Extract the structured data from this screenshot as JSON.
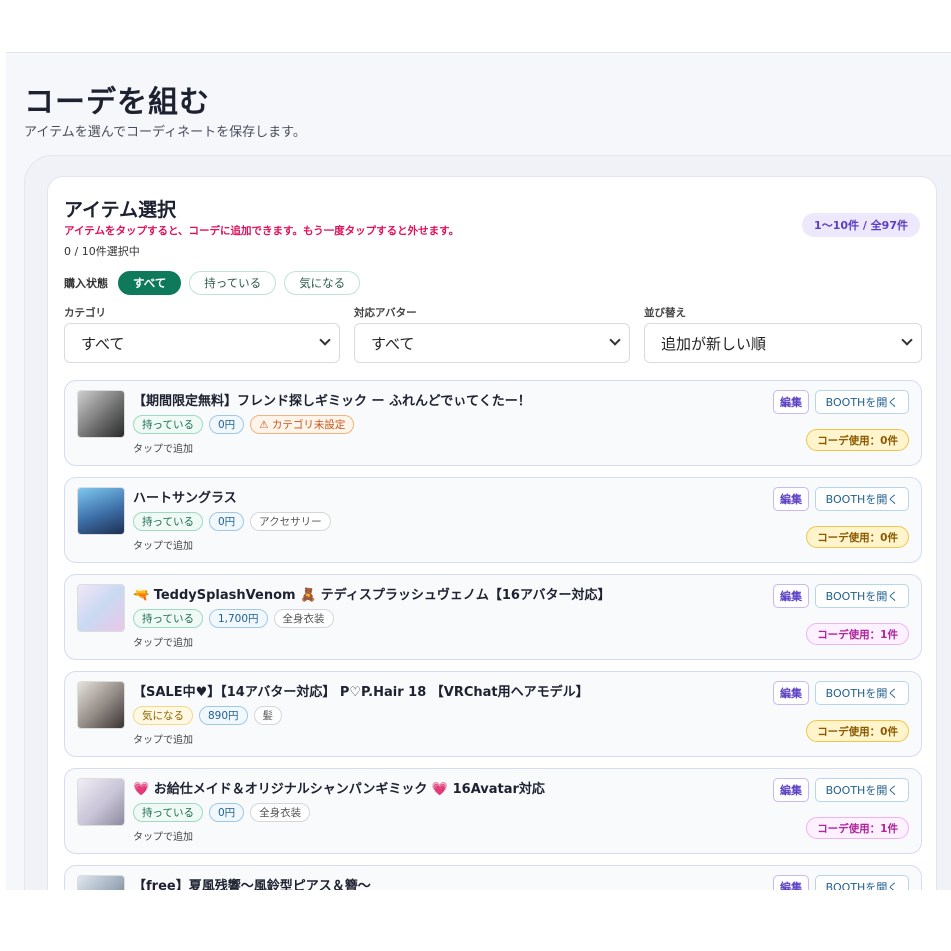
{
  "page": {
    "title": "コーデを組む",
    "subtitle": "アイテムを選んでコーディネートを保存します。"
  },
  "picker": {
    "title": "アイテム選択",
    "hint": "アイテムをタップすると、コーデに追加できます。もう一度タップすると外せます。",
    "selected_count": "0 / 10件選択中",
    "range": "1〜10件 / 全97件",
    "status_label": "購入状態",
    "status_options": [
      "すべて",
      "持っている",
      "気になる"
    ],
    "filters": {
      "category": {
        "label": "カテゴリ",
        "value": "すべて"
      },
      "avatar": {
        "label": "対応アバター",
        "value": "すべて"
      },
      "sort": {
        "label": "並び替え",
        "value": "追加が新しい順"
      }
    }
  },
  "item_labels": {
    "tap": "タップで追加",
    "edit": "編集",
    "booth": "BOOTHを開く"
  },
  "items": [
    {
      "title": "【期間限定無料】フレンド探しギミック ー ふれんどでぃてくたー！",
      "tags": [
        "持っている",
        "0円",
        "⚠ カテゴリ未設定"
      ],
      "usage": "コーデ使用：0件"
    },
    {
      "title": "ハートサングラス",
      "tags": [
        "持っている",
        "0円",
        "アクセサリー"
      ],
      "usage": "コーデ使用：0件"
    },
    {
      "title": "🔫 TeddySplashVenom 🧸 テディスプラッシュヴェノム【16アバター対応】",
      "tags": [
        "持っている",
        "1,700円",
        "全身衣装"
      ],
      "usage": "コーデ使用：1件"
    },
    {
      "title": "【SALE中♥】【14アバター対応】 P♡P.Hair 18 【VRChat用ヘアモデル】",
      "tags": [
        "気になる",
        "890円",
        "髪"
      ],
      "usage": "コーデ使用：0件"
    },
    {
      "title": "💗 お給仕メイド＆オリジナルシャンパンギミック 💗 16Avatar対応",
      "tags": [
        "持っている",
        "0円",
        "全身衣装"
      ],
      "usage": "コーデ使用：1件"
    },
    {
      "title": "【free】夏風残響〜風鈴型ピアス＆簪〜",
      "tags": [],
      "usage": ""
    }
  ],
  "colors": {
    "accent_green": "#0f7a5b",
    "hint_red": "#e0105a",
    "purple": "#5b3fc4"
  }
}
